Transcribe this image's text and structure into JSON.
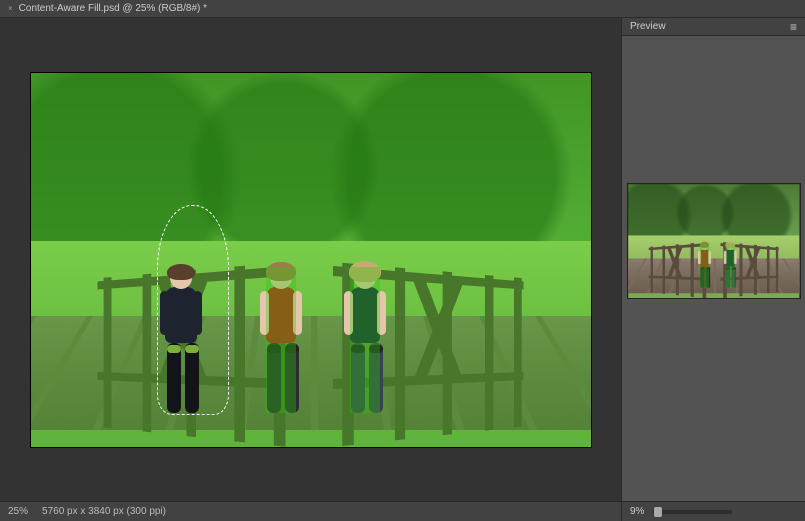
{
  "titlebar": {
    "close_glyph": "×",
    "document_title": "Content-Aware Fill.psd @ 25% (RGB/8#) *"
  },
  "canvas": {
    "overlay_color": "#28c80a",
    "overlay_opacity_pct": 35,
    "selection_target": "left-person"
  },
  "status": {
    "zoom": "25%",
    "dimensions": "5760 px x 3840 px (300 ppi)"
  },
  "panel": {
    "title": "Preview",
    "menu_glyph": "≡",
    "zoom_label": "9%"
  }
}
